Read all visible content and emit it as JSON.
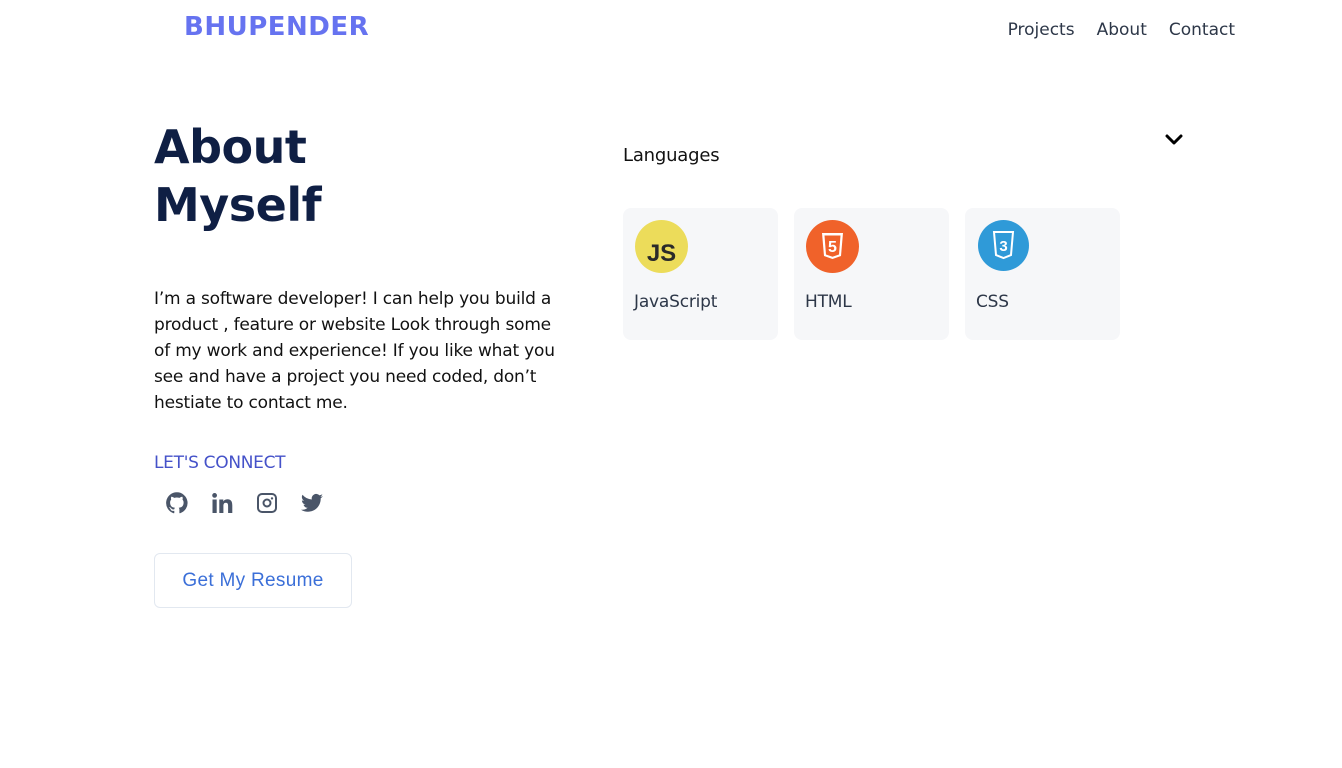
{
  "header": {
    "brand": "BHUPENDER",
    "nav": [
      "Projects",
      "About",
      "Contact"
    ]
  },
  "about": {
    "title_line1": "About",
    "title_line2": "Myself",
    "bio": "I’m a software developer! I can help you build a product , feature or website Look through some of my work and experience! If you like what you see and have a project you need coded, don’t hestiate to contact me.",
    "connect_label": "LET'S CONNECT",
    "socials": [
      "github-icon",
      "linkedin-icon",
      "instagram-icon",
      "twitter-icon"
    ],
    "resume_button": "Get My Resume"
  },
  "skills": {
    "section_label": "Languages",
    "items": [
      {
        "name": "JavaScript",
        "logo_text": "JS",
        "color": "#f0db4f"
      },
      {
        "name": "HTML",
        "logo_text": "5",
        "color": "#f16529"
      },
      {
        "name": "CSS",
        "logo_text": "3",
        "color": "#2f9ad8"
      }
    ]
  },
  "colors": {
    "brand": "#6673f0",
    "title": "#0f1f44",
    "connect": "#4552c9",
    "resume_text": "#3b6fd8",
    "card_bg": "#f6f7f9"
  }
}
